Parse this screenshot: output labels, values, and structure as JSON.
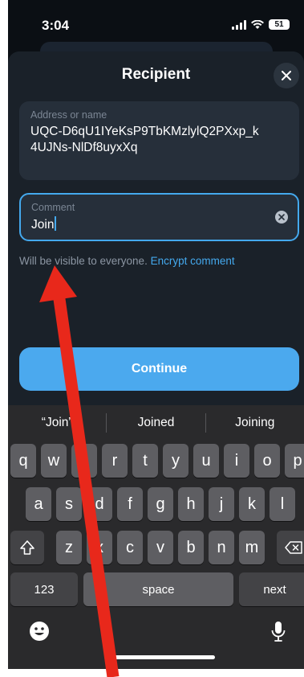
{
  "status_bar": {
    "time": "3:04",
    "battery": "51"
  },
  "sheet": {
    "title": "Recipient",
    "address_label": "Address or name",
    "address_value": "UQC-D6qU1IYeKsP9TbKMzlylQ2PXxp_k4UJNs-NlDf8uyxXq",
    "comment_label": "Comment",
    "comment_value": "Join",
    "hint_text": "Will be visible to everyone. ",
    "hint_link": "Encrypt comment",
    "continue_label": "Continue"
  },
  "keyboard": {
    "suggestions": [
      "“Join”",
      "Joined",
      "Joining"
    ],
    "row1": [
      "q",
      "w",
      "e",
      "r",
      "t",
      "y",
      "u",
      "i",
      "o",
      "p"
    ],
    "row2": [
      "a",
      "s",
      "d",
      "f",
      "g",
      "h",
      "j",
      "k",
      "l"
    ],
    "row3": [
      "z",
      "x",
      "c",
      "v",
      "b",
      "n",
      "m"
    ],
    "numbers_label": "123",
    "space_label": "space",
    "next_label": "next"
  },
  "colors": {
    "accent": "#44a9ee",
    "annotation_arrow": "#e8281b"
  },
  "icons": [
    "close-icon",
    "clear-icon",
    "shift-icon",
    "backspace-icon",
    "emoji-icon",
    "microphone-icon"
  ]
}
